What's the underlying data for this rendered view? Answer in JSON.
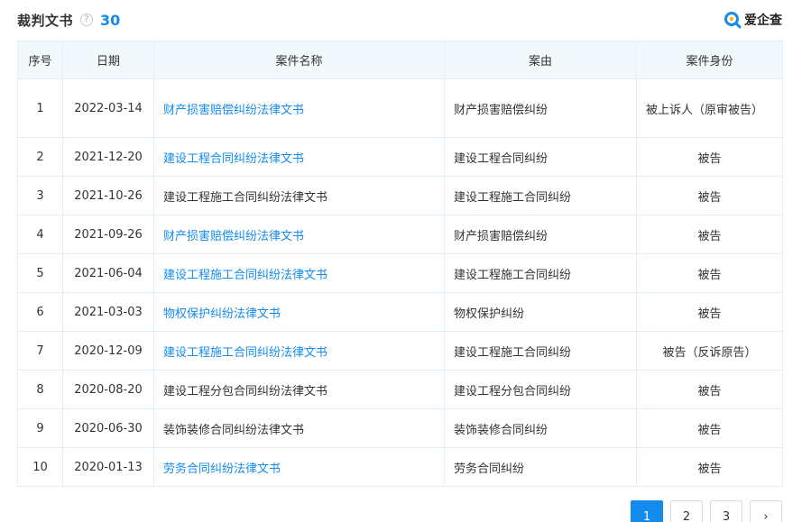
{
  "header": {
    "title": "裁判文书",
    "help_glyph": "?",
    "count": "30",
    "brand": "爱企查"
  },
  "columns": [
    "序号",
    "日期",
    "案件名称",
    "案由",
    "案件身份"
  ],
  "rows": [
    {
      "no": "1",
      "date": "2022-03-14",
      "name": "财产损害赔偿纠纷法律文书",
      "name_is_link": true,
      "cause": "财产损害赔偿纠纷",
      "role": "被上诉人（原审被告）"
    },
    {
      "no": "2",
      "date": "2021-12-20",
      "name": "建设工程合同纠纷法律文书",
      "name_is_link": true,
      "cause": "建设工程合同纠纷",
      "role": "被告"
    },
    {
      "no": "3",
      "date": "2021-10-26",
      "name": "建设工程施工合同纠纷法律文书",
      "name_is_link": false,
      "cause": "建设工程施工合同纠纷",
      "role": "被告"
    },
    {
      "no": "4",
      "date": "2021-09-26",
      "name": "财产损害赔偿纠纷法律文书",
      "name_is_link": true,
      "cause": "财产损害赔偿纠纷",
      "role": "被告"
    },
    {
      "no": "5",
      "date": "2021-06-04",
      "name": "建设工程施工合同纠纷法律文书",
      "name_is_link": true,
      "cause": "建设工程施工合同纠纷",
      "role": "被告"
    },
    {
      "no": "6",
      "date": "2021-03-03",
      "name": "物权保护纠纷法律文书",
      "name_is_link": true,
      "cause": "物权保护纠纷",
      "role": "被告"
    },
    {
      "no": "7",
      "date": "2020-12-09",
      "name": "建设工程施工合同纠纷法律文书",
      "name_is_link": true,
      "cause": "建设工程施工合同纠纷",
      "role": "被告（反诉原告）"
    },
    {
      "no": "8",
      "date": "2020-08-20",
      "name": "建设工程分包合同纠纷法律文书",
      "name_is_link": false,
      "cause": "建设工程分包合同纠纷",
      "role": "被告"
    },
    {
      "no": "9",
      "date": "2020-06-30",
      "name": "装饰装修合同纠纷法律文书",
      "name_is_link": false,
      "cause": "装饰装修合同纠纷",
      "role": "被告"
    },
    {
      "no": "10",
      "date": "2020-01-13",
      "name": "劳务合同纠纷法律文书",
      "name_is_link": true,
      "cause": "劳务合同纠纷",
      "role": "被告"
    }
  ],
  "pagination": {
    "pages": [
      "1",
      "2",
      "3"
    ],
    "current": "1",
    "next_glyph": "›"
  },
  "colors": {
    "accent": "#128bed",
    "header_bg": "#f2f9fc",
    "border": "#e4eef6"
  }
}
